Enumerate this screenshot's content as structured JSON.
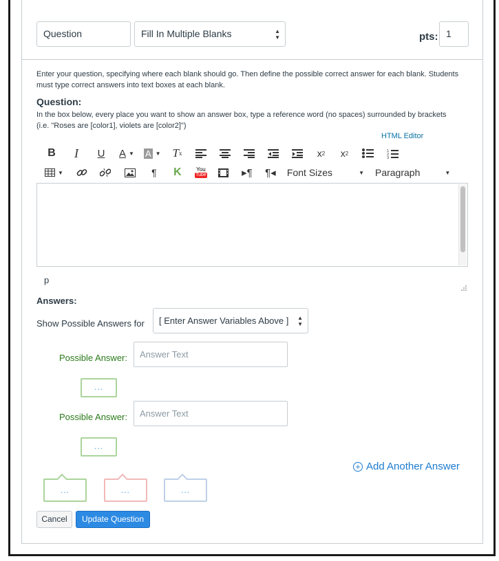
{
  "header": {
    "question_name": "Question",
    "question_type": "Fill In Multiple Blanks",
    "points_label": "pts:",
    "points_value": "1"
  },
  "instructions": "Enter your question, specifying where each blank should go. Then define the possible correct answer for each blank. Students must type correct answers into text boxes at each blank.",
  "question_heading": "Question:",
  "question_help_line1": "In the box below, every place you want to show an answer box, type a reference word (no spaces) surrounded by brackets",
  "question_help_line2": "(i.e. \"Roses are [color1], violets are [color2]\")",
  "html_editor_link": "HTML Editor",
  "toolbar": {
    "font_sizes": "Font Sizes",
    "paragraph": "Paragraph",
    "youtube_top": "You",
    "youtube_bottom": "Tube"
  },
  "editor": {
    "path": "p"
  },
  "answers": {
    "heading": "Answers:",
    "show_label": "Show Possible Answers for",
    "variable_select": "[ Enter Answer Variables Above ]",
    "possible_answer_label": "Possible Answer:",
    "answer_placeholder": "Answer Text",
    "comment_ellipsis": "...",
    "add_another": "Add Another Answer"
  },
  "feedback_bubbles": [
    "...",
    "...",
    "..."
  ],
  "buttons": {
    "cancel": "Cancel",
    "update": "Update Question"
  },
  "colors": {
    "link_blue": "#1d7bd0",
    "possible_answer_green": "#2a7a1a",
    "update_button": "#2d8ae3",
    "bubble_correct": "#aad49b",
    "bubble_incorrect": "#f2b8b8",
    "bubble_neutral": "#bdd0e8"
  }
}
